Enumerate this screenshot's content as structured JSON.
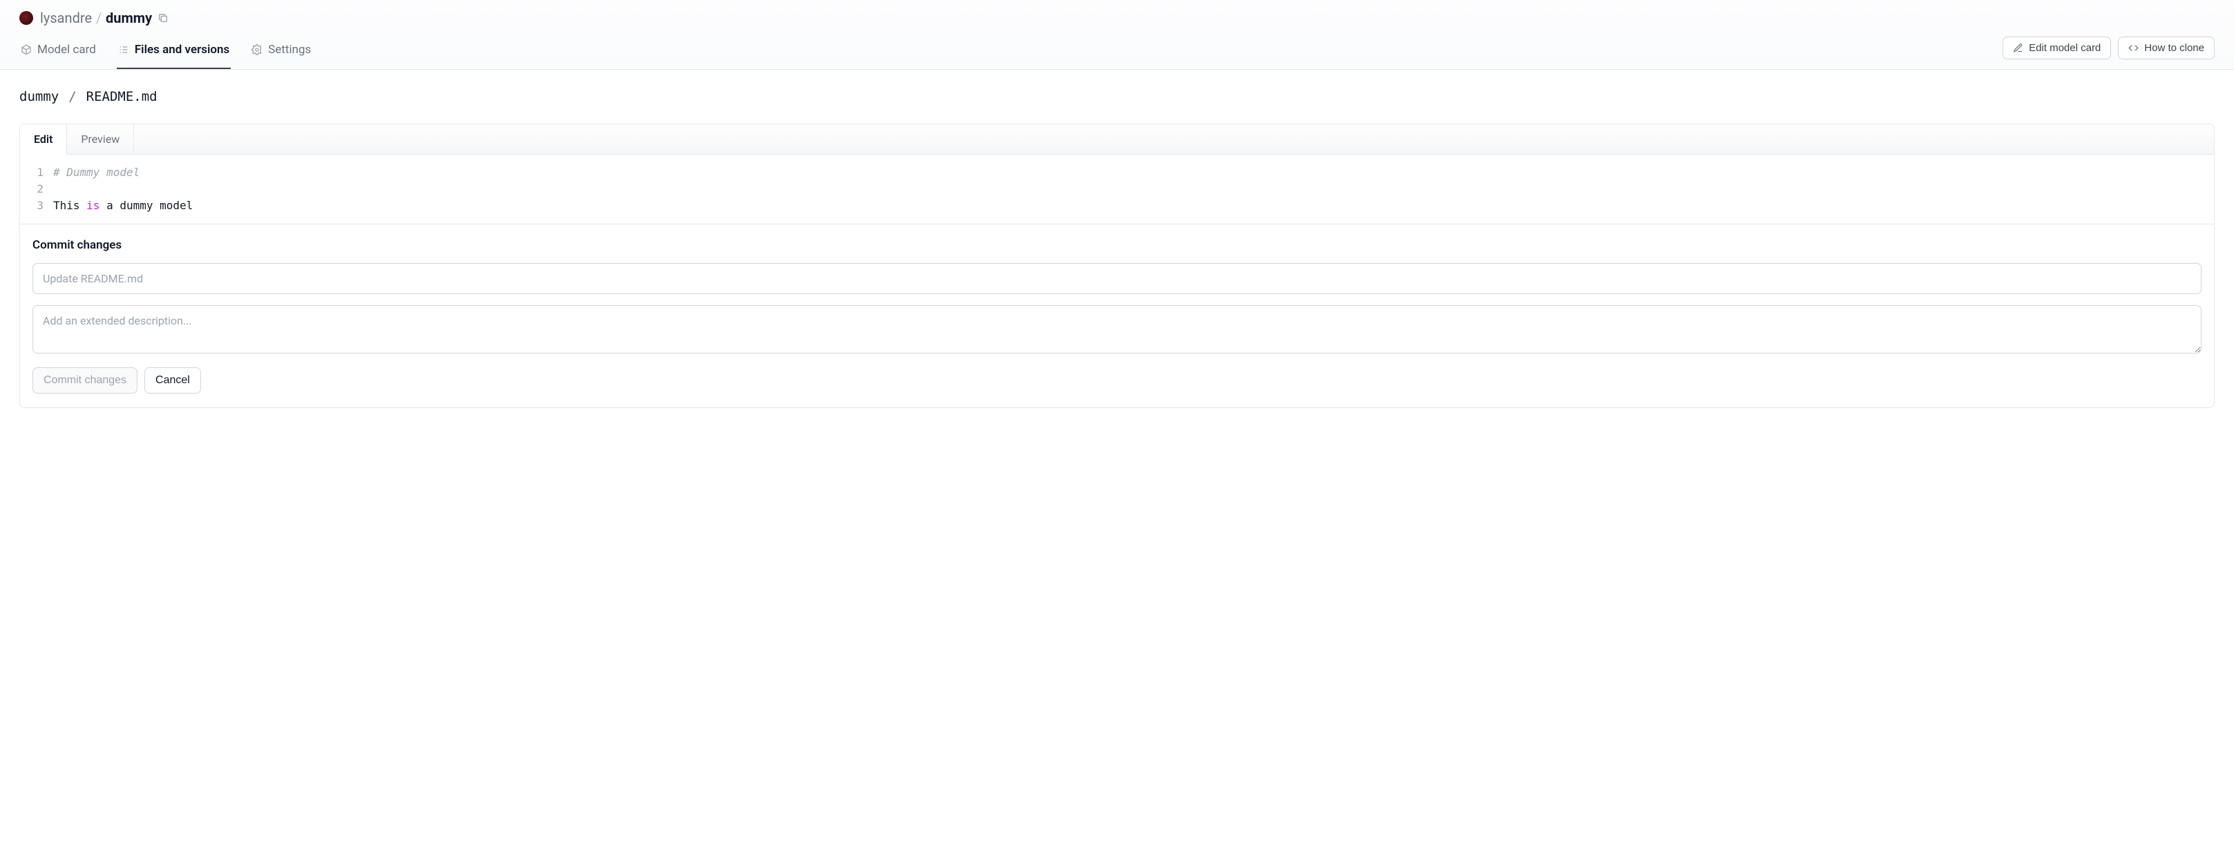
{
  "header": {
    "owner": "lysandre",
    "separator": "/",
    "repo": "dummy"
  },
  "nav": {
    "tabs": [
      {
        "id": "model-card",
        "label": "Model card",
        "icon": "cube-icon",
        "active": false
      },
      {
        "id": "files",
        "label": "Files and versions",
        "icon": "list-icon",
        "active": true
      },
      {
        "id": "settings",
        "label": "Settings",
        "icon": "gear-icon",
        "active": false
      }
    ],
    "actions": {
      "edit_model_card": "Edit model card",
      "how_to_clone": "How to clone"
    }
  },
  "path": {
    "segments": [
      "dummy",
      "README.md"
    ]
  },
  "editor": {
    "tabs": {
      "edit": "Edit",
      "preview": "Preview",
      "active": "edit"
    },
    "lines": [
      {
        "n": 1,
        "tokens": [
          {
            "t": "# Dummy model",
            "cls": "comment"
          }
        ]
      },
      {
        "n": 2,
        "tokens": [
          {
            "t": "",
            "cls": ""
          }
        ]
      },
      {
        "n": 3,
        "tokens": [
          {
            "t": "This ",
            "cls": ""
          },
          {
            "t": "is",
            "cls": "kw"
          },
          {
            "t": " a dummy model",
            "cls": ""
          }
        ]
      }
    ]
  },
  "commit": {
    "heading": "Commit changes",
    "summary_placeholder": "Update README.md",
    "description_placeholder": "Add an extended description...",
    "summary_value": "",
    "description_value": "",
    "commit_button": "Commit changes",
    "cancel_button": "Cancel"
  }
}
